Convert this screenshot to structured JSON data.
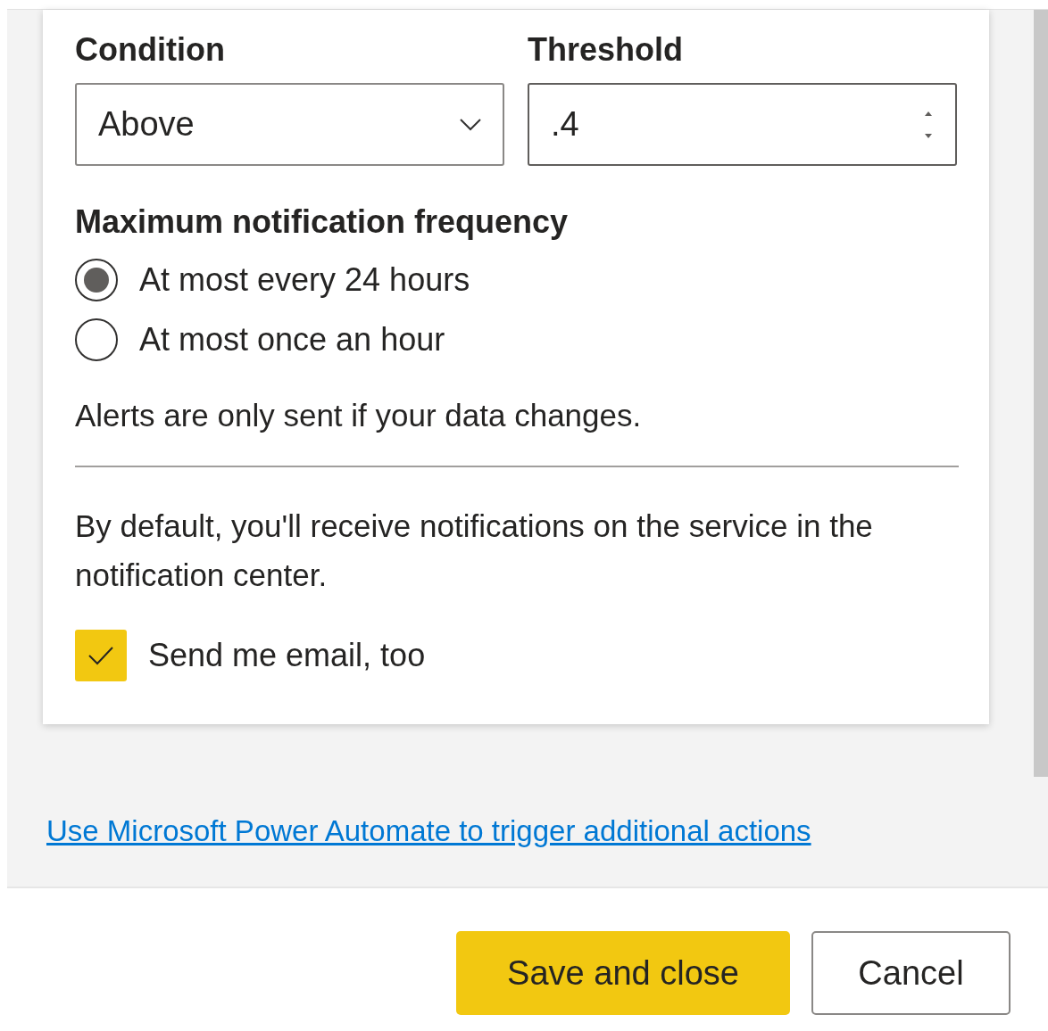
{
  "condition": {
    "label": "Condition",
    "value": "Above"
  },
  "threshold": {
    "label": "Threshold",
    "value": ".4"
  },
  "frequency": {
    "heading": "Maximum notification frequency",
    "options": [
      {
        "label": "At most every 24 hours",
        "selected": true
      },
      {
        "label": "At most once an hour",
        "selected": false
      }
    ]
  },
  "alert_note": "Alerts are only sent if your data changes.",
  "default_note": "By default, you'll receive notifications on the service in the notification center.",
  "email": {
    "label": "Send me email, too",
    "checked": true
  },
  "link": "Use Microsoft Power Automate to trigger additional actions",
  "buttons": [
    {
      "label": "Save and close",
      "kind": "primary"
    },
    {
      "label": "Cancel",
      "kind": "secondary"
    }
  ]
}
